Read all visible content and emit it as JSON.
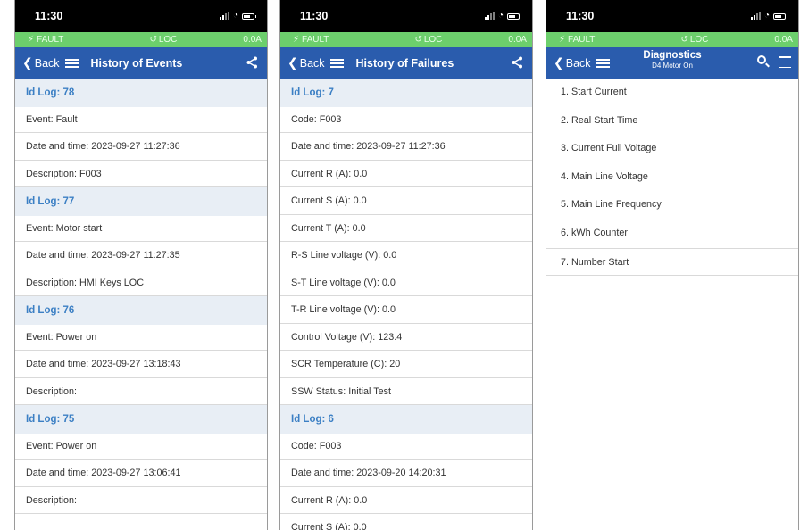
{
  "status": {
    "time": "11:30",
    "fault_label": "FAULT",
    "loc_label": "LOC",
    "current_label": "0.0A"
  },
  "colors": {
    "status_bar": "#000000",
    "fault_bar": "#6ccf6c",
    "nav_bar": "#2a5cad",
    "group_header_bg": "#e8eef5",
    "group_header_text": "#3b7fc4"
  },
  "icons": [
    "back-chevron-icon",
    "menu-icon",
    "share-icon",
    "search-icon",
    "filter-icon",
    "fault-icon",
    "loc-icon",
    "signal-icon",
    "wifi-icon",
    "battery-icon"
  ],
  "events_screen": {
    "back_label": "Back",
    "title": "History of Events",
    "logs": [
      {
        "id": "Id Log: 78",
        "event": "Event: Fault",
        "datetime": "Date and time: 2023-09-27 11:27:36",
        "description": "Description: F003"
      },
      {
        "id": "Id Log: 77",
        "event": "Event: Motor start",
        "datetime": "Date and time: 2023-09-27 11:27:35",
        "description": "Description: HMI Keys LOC"
      },
      {
        "id": "Id Log: 76",
        "event": "Event: Power on",
        "datetime": "Date and time: 2023-09-27 13:18:43",
        "description": "Description:"
      },
      {
        "id": "Id Log: 75",
        "event": "Event: Power on",
        "datetime": "Date and time: 2023-09-27 13:06:41",
        "description": "Description:"
      }
    ]
  },
  "failures_screen": {
    "back_label": "Back",
    "title": "History of Failures",
    "logs": [
      {
        "id": "Id Log: 7",
        "fields": [
          "Code: F003",
          "Date and time: 2023-09-27 11:27:36",
          "Current R (A): 0.0",
          "Current S (A): 0.0",
          "Current T (A): 0.0",
          "R-S Line voltage (V): 0.0",
          "S-T Line voltage (V): 0.0",
          "T-R Line voltage (V): 0.0",
          "Control Voltage (V): 123.4",
          "SCR Temperature (C): 20",
          "SSW Status: Initial Test"
        ]
      },
      {
        "id": "Id Log: 6",
        "fields": [
          "Code: F003",
          "Date and time: 2023-09-20 14:20:31",
          "Current R (A): 0.0",
          "Current S (A): 0.0"
        ]
      }
    ]
  },
  "diagnostics_screen": {
    "back_label": "Back",
    "title": "Diagnostics",
    "subtitle": "D4 Motor On",
    "items": [
      "1. Start Current",
      "2. Real Start Time",
      "3. Current Full Voltage",
      "4. Main Line Voltage",
      "5. Main Line Frequency",
      "6. kWh Counter",
      "7. Number Start"
    ]
  }
}
